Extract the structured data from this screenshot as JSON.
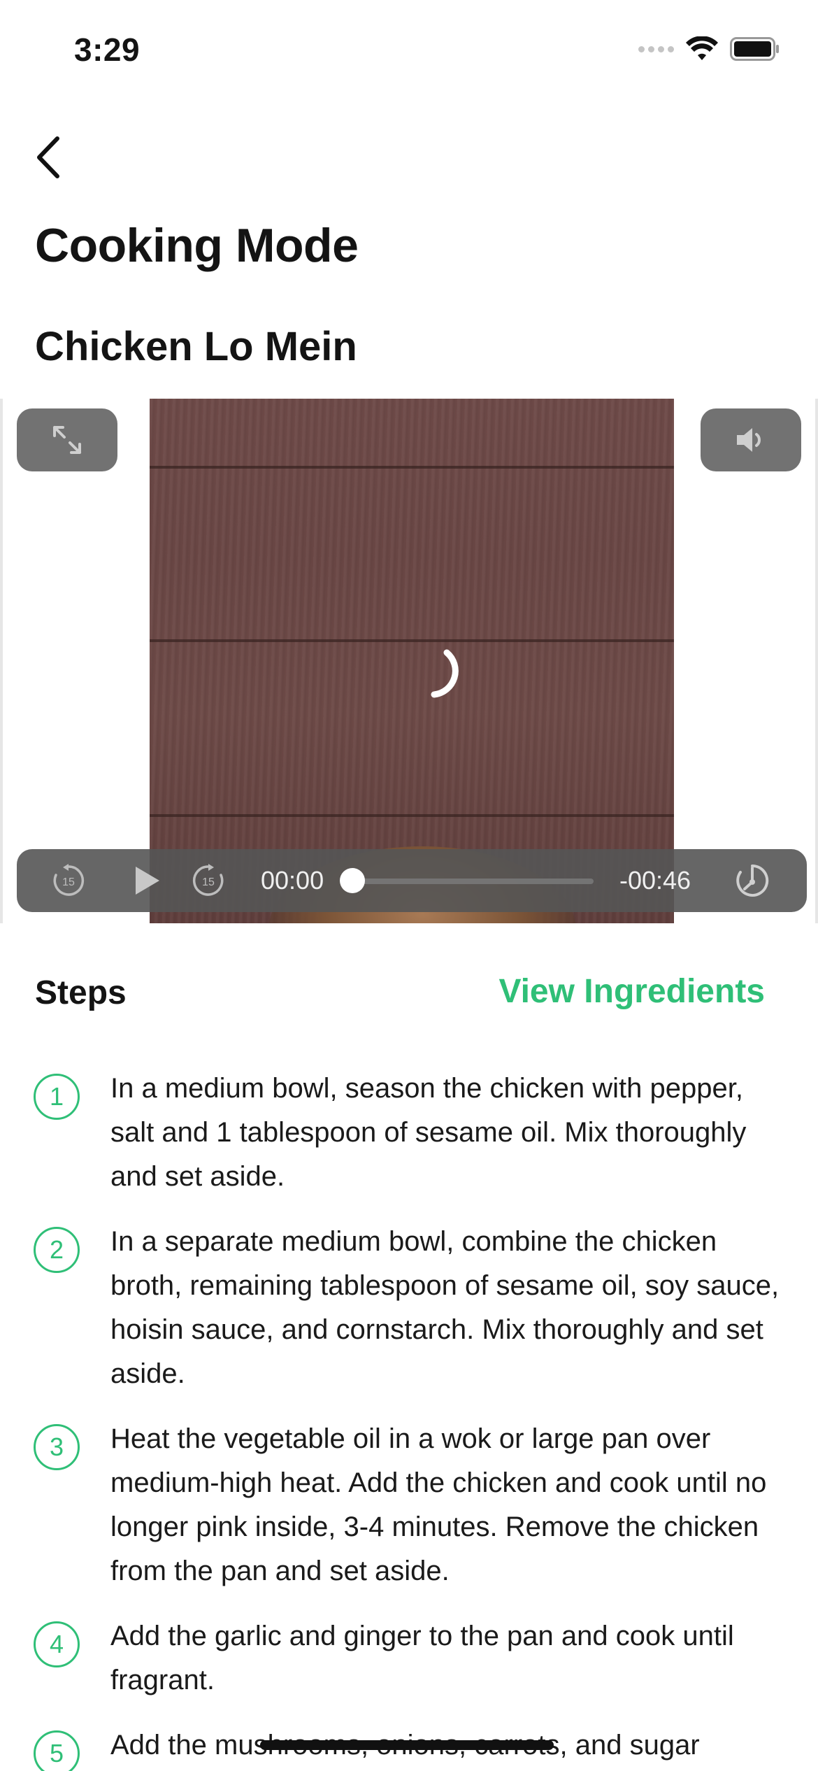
{
  "status_bar": {
    "time": "3:29"
  },
  "header": {
    "title": "Cooking Mode"
  },
  "recipe": {
    "name": "Chicken Lo Mein"
  },
  "video": {
    "skip_back_label": "15",
    "skip_forward_label": "15",
    "current_time": "00:00",
    "remaining_time": "-00:46",
    "progress": 0
  },
  "steps_section": {
    "label": "Steps",
    "view_ingredients_label": "View Ingredients",
    "steps": [
      {
        "number": "1",
        "text": "In a medium bowl, season the chicken with pepper, salt and 1 tablespoon of sesame oil. Mix thoroughly and set aside."
      },
      {
        "number": "2",
        "text": "In a separate medium bowl, combine the chicken broth, remaining tablespoon of sesame oil, soy sauce, hoisin sauce, and cornstarch. Mix thoroughly and set aside."
      },
      {
        "number": "3",
        "text": "Heat the vegetable oil in a wok or large pan over medium-high heat. Add the chicken and cook until no longer pink inside, 3-4 minutes. Remove the chicken from the pan and set aside."
      },
      {
        "number": "4",
        "text": "Add the garlic and ginger to the pan and cook until fragrant."
      },
      {
        "number": "5",
        "text": "Add the mushrooms, onions, carrots, and sugar"
      }
    ]
  },
  "colors": {
    "accent": "#2fbf77",
    "text": "#141414",
    "control_bg": "#555555"
  }
}
